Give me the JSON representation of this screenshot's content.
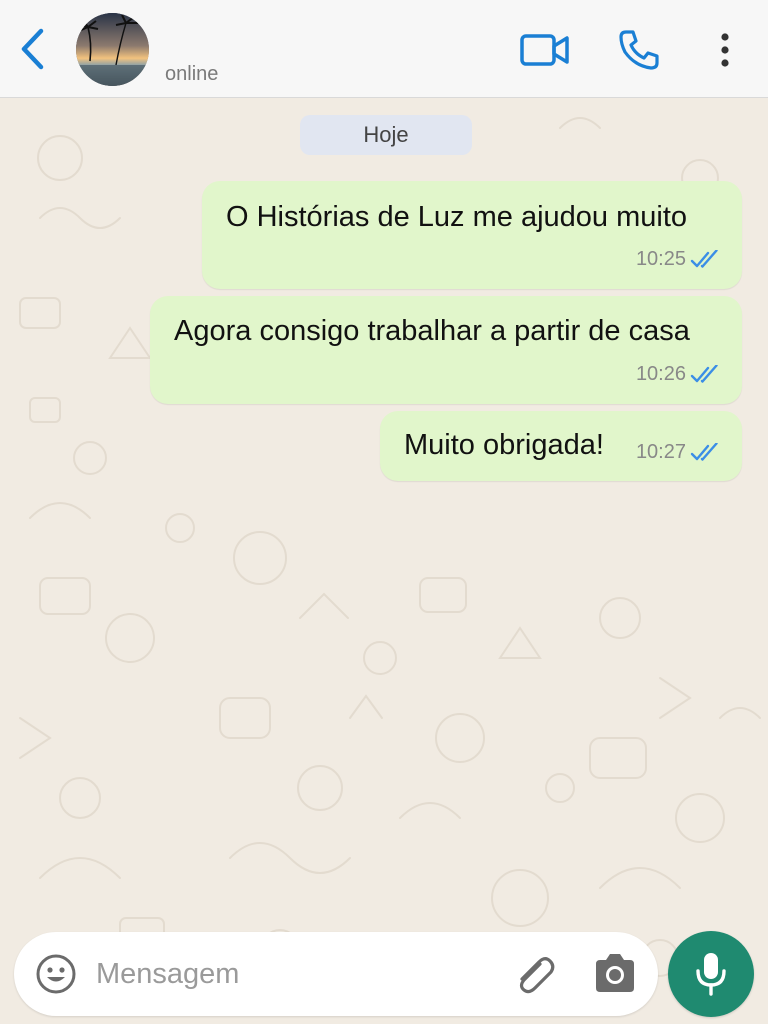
{
  "header": {
    "status": "online",
    "icons": {
      "back": "chevron-left-icon",
      "video": "video-camera-icon",
      "call": "phone-icon",
      "menu": "more-vertical-icon"
    },
    "accent_color": "#1a7fd4"
  },
  "chat": {
    "date_divider": "Hoje",
    "messages": [
      {
        "text": "O Histórias de Luz me ajudou muito",
        "time": "10:25",
        "status": "read"
      },
      {
        "text": "Agora consigo trabalhar a partir de casa",
        "time": "10:26",
        "status": "read"
      },
      {
        "text": "Muito obrigada!",
        "time": "10:27",
        "status": "read"
      }
    ],
    "bubble_color": "#e1f6cb",
    "read_tick_color": "#3b8ee6"
  },
  "composer": {
    "placeholder": "Mensagem",
    "value": "",
    "icons": {
      "emoji": "emoji-icon",
      "attach": "paperclip-icon",
      "camera": "camera-icon",
      "mic": "microphone-icon"
    },
    "mic_button_color": "#1f8a70"
  }
}
